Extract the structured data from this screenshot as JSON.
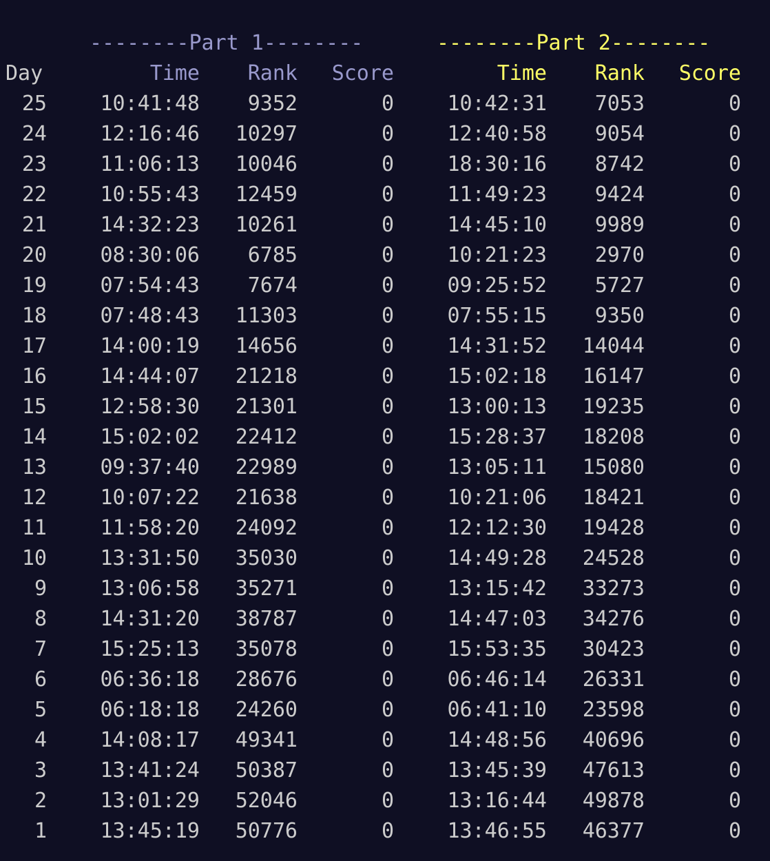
{
  "header": {
    "part1_banner": "--------Part 1--------",
    "part2_banner": "--------Part 2--------",
    "day": "Day",
    "time": "Time",
    "rank": "Rank",
    "score": "Score"
  },
  "colors": {
    "background": "#0f0f23",
    "text": "#cccccc",
    "part1": "#9999cc",
    "part2": "#ffff66"
  },
  "rows": [
    {
      "day": "25",
      "p1_time": "10:41:48",
      "p1_rank": "9352",
      "p1_score": "0",
      "p2_time": "10:42:31",
      "p2_rank": "7053",
      "p2_score": "0"
    },
    {
      "day": "24",
      "p1_time": "12:16:46",
      "p1_rank": "10297",
      "p1_score": "0",
      "p2_time": "12:40:58",
      "p2_rank": "9054",
      "p2_score": "0"
    },
    {
      "day": "23",
      "p1_time": "11:06:13",
      "p1_rank": "10046",
      "p1_score": "0",
      "p2_time": "18:30:16",
      "p2_rank": "8742",
      "p2_score": "0"
    },
    {
      "day": "22",
      "p1_time": "10:55:43",
      "p1_rank": "12459",
      "p1_score": "0",
      "p2_time": "11:49:23",
      "p2_rank": "9424",
      "p2_score": "0"
    },
    {
      "day": "21",
      "p1_time": "14:32:23",
      "p1_rank": "10261",
      "p1_score": "0",
      "p2_time": "14:45:10",
      "p2_rank": "9989",
      "p2_score": "0"
    },
    {
      "day": "20",
      "p1_time": "08:30:06",
      "p1_rank": "6785",
      "p1_score": "0",
      "p2_time": "10:21:23",
      "p2_rank": "2970",
      "p2_score": "0"
    },
    {
      "day": "19",
      "p1_time": "07:54:43",
      "p1_rank": "7674",
      "p1_score": "0",
      "p2_time": "09:25:52",
      "p2_rank": "5727",
      "p2_score": "0"
    },
    {
      "day": "18",
      "p1_time": "07:48:43",
      "p1_rank": "11303",
      "p1_score": "0",
      "p2_time": "07:55:15",
      "p2_rank": "9350",
      "p2_score": "0"
    },
    {
      "day": "17",
      "p1_time": "14:00:19",
      "p1_rank": "14656",
      "p1_score": "0",
      "p2_time": "14:31:52",
      "p2_rank": "14044",
      "p2_score": "0"
    },
    {
      "day": "16",
      "p1_time": "14:44:07",
      "p1_rank": "21218",
      "p1_score": "0",
      "p2_time": "15:02:18",
      "p2_rank": "16147",
      "p2_score": "0"
    },
    {
      "day": "15",
      "p1_time": "12:58:30",
      "p1_rank": "21301",
      "p1_score": "0",
      "p2_time": "13:00:13",
      "p2_rank": "19235",
      "p2_score": "0"
    },
    {
      "day": "14",
      "p1_time": "15:02:02",
      "p1_rank": "22412",
      "p1_score": "0",
      "p2_time": "15:28:37",
      "p2_rank": "18208",
      "p2_score": "0"
    },
    {
      "day": "13",
      "p1_time": "09:37:40",
      "p1_rank": "22989",
      "p1_score": "0",
      "p2_time": "13:05:11",
      "p2_rank": "15080",
      "p2_score": "0"
    },
    {
      "day": "12",
      "p1_time": "10:07:22",
      "p1_rank": "21638",
      "p1_score": "0",
      "p2_time": "10:21:06",
      "p2_rank": "18421",
      "p2_score": "0"
    },
    {
      "day": "11",
      "p1_time": "11:58:20",
      "p1_rank": "24092",
      "p1_score": "0",
      "p2_time": "12:12:30",
      "p2_rank": "19428",
      "p2_score": "0"
    },
    {
      "day": "10",
      "p1_time": "13:31:50",
      "p1_rank": "35030",
      "p1_score": "0",
      "p2_time": "14:49:28",
      "p2_rank": "24528",
      "p2_score": "0"
    },
    {
      "day": "9",
      "p1_time": "13:06:58",
      "p1_rank": "35271",
      "p1_score": "0",
      "p2_time": "13:15:42",
      "p2_rank": "33273",
      "p2_score": "0"
    },
    {
      "day": "8",
      "p1_time": "14:31:20",
      "p1_rank": "38787",
      "p1_score": "0",
      "p2_time": "14:47:03",
      "p2_rank": "34276",
      "p2_score": "0"
    },
    {
      "day": "7",
      "p1_time": "15:25:13",
      "p1_rank": "35078",
      "p1_score": "0",
      "p2_time": "15:53:35",
      "p2_rank": "30423",
      "p2_score": "0"
    },
    {
      "day": "6",
      "p1_time": "06:36:18",
      "p1_rank": "28676",
      "p1_score": "0",
      "p2_time": "06:46:14",
      "p2_rank": "26331",
      "p2_score": "0"
    },
    {
      "day": "5",
      "p1_time": "06:18:18",
      "p1_rank": "24260",
      "p1_score": "0",
      "p2_time": "06:41:10",
      "p2_rank": "23598",
      "p2_score": "0"
    },
    {
      "day": "4",
      "p1_time": "14:08:17",
      "p1_rank": "49341",
      "p1_score": "0",
      "p2_time": "14:48:56",
      "p2_rank": "40696",
      "p2_score": "0"
    },
    {
      "day": "3",
      "p1_time": "13:41:24",
      "p1_rank": "50387",
      "p1_score": "0",
      "p2_time": "13:45:39",
      "p2_rank": "47613",
      "p2_score": "0"
    },
    {
      "day": "2",
      "p1_time": "13:01:29",
      "p1_rank": "52046",
      "p1_score": "0",
      "p2_time": "13:16:44",
      "p2_rank": "49878",
      "p2_score": "0"
    },
    {
      "day": "1",
      "p1_time": "13:45:19",
      "p1_rank": "50776",
      "p1_score": "0",
      "p2_time": "13:46:55",
      "p2_rank": "46377",
      "p2_score": "0"
    }
  ]
}
